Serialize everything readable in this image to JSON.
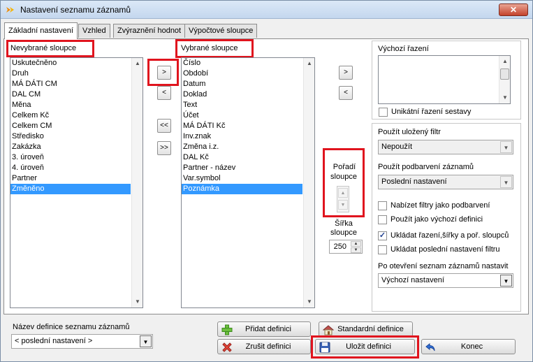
{
  "window": {
    "title": "Nastavení seznamu záznamů",
    "close_label": "✕"
  },
  "tabs": [
    {
      "label": "Základní nastavení",
      "active": true
    },
    {
      "label": "Vzhled"
    },
    {
      "label": "Zvýraznění hodnot"
    },
    {
      "label": "Výpočtové sloupce"
    }
  ],
  "unselected": {
    "label": "Nevybrané sloupce",
    "items": [
      "Uskutečněno",
      "Druh",
      "MÁ DÁTI  CM",
      "DAL  CM",
      "Měna",
      "Celkem Kč",
      "Celkem CM",
      "Středisko",
      "Zakázka",
      "3. úroveň",
      "4. úroveň",
      "Partner",
      "Změněno"
    ],
    "selected_index": 12
  },
  "selected": {
    "label": "Vybrané sloupce",
    "items": [
      "Číslo",
      "Období",
      "Datum",
      "Doklad",
      "Text",
      "Účet",
      "MÁ DÁTI  Kč",
      "Inv.znak",
      "Změna i.z.",
      "DAL  Kč",
      "Partner - název",
      "Var.symbol",
      "Poznámka"
    ],
    "selected_index": 12
  },
  "transfer": {
    "add_one": ">",
    "remove_one": "<",
    "remove_all": "<<",
    "add_all": ">>"
  },
  "order": {
    "label_line1": "Pořadí",
    "label_line2": "sloupce",
    "up": "▲",
    "down": "▼"
  },
  "width": {
    "label_line1": "Šířka",
    "label_line2": "sloupce",
    "value": "250"
  },
  "sort": {
    "move_right": ">",
    "move_left": "<",
    "label": "Výchozí řazení",
    "unique_label": "Unikátní řazení sestavy",
    "unique_checked": false
  },
  "filter": {
    "label": "Použít uložený filtr",
    "value": "Nepoužít",
    "coloring_label": "Použít podbarvení záznamů",
    "coloring_value": "Poslední nastavení"
  },
  "options": [
    {
      "label": "Nabízet filtry jako podbarvení",
      "checked": false
    },
    {
      "label": "Použít jako výchozí definici",
      "checked": false
    },
    {
      "label": "Ukládat řazení,šířky a poř. sloupců",
      "checked": true
    },
    {
      "label": "Ukládat poslední nastavení filtru",
      "checked": false
    }
  ],
  "on_open": {
    "label": "Po otevření seznam záznamů nastavit",
    "value": "Výchozí nastavení"
  },
  "definition": {
    "label": "Název definice seznamu záznamů",
    "value": "< poslední nastavení >"
  },
  "buttons": {
    "add": "Přidat definici",
    "default": "Standardní definice",
    "delete": "Zrušit definici",
    "save": "Uložit definici",
    "close": "Konec"
  },
  "colors": {
    "highlight": "#e0141e",
    "selection": "#3399ff"
  }
}
